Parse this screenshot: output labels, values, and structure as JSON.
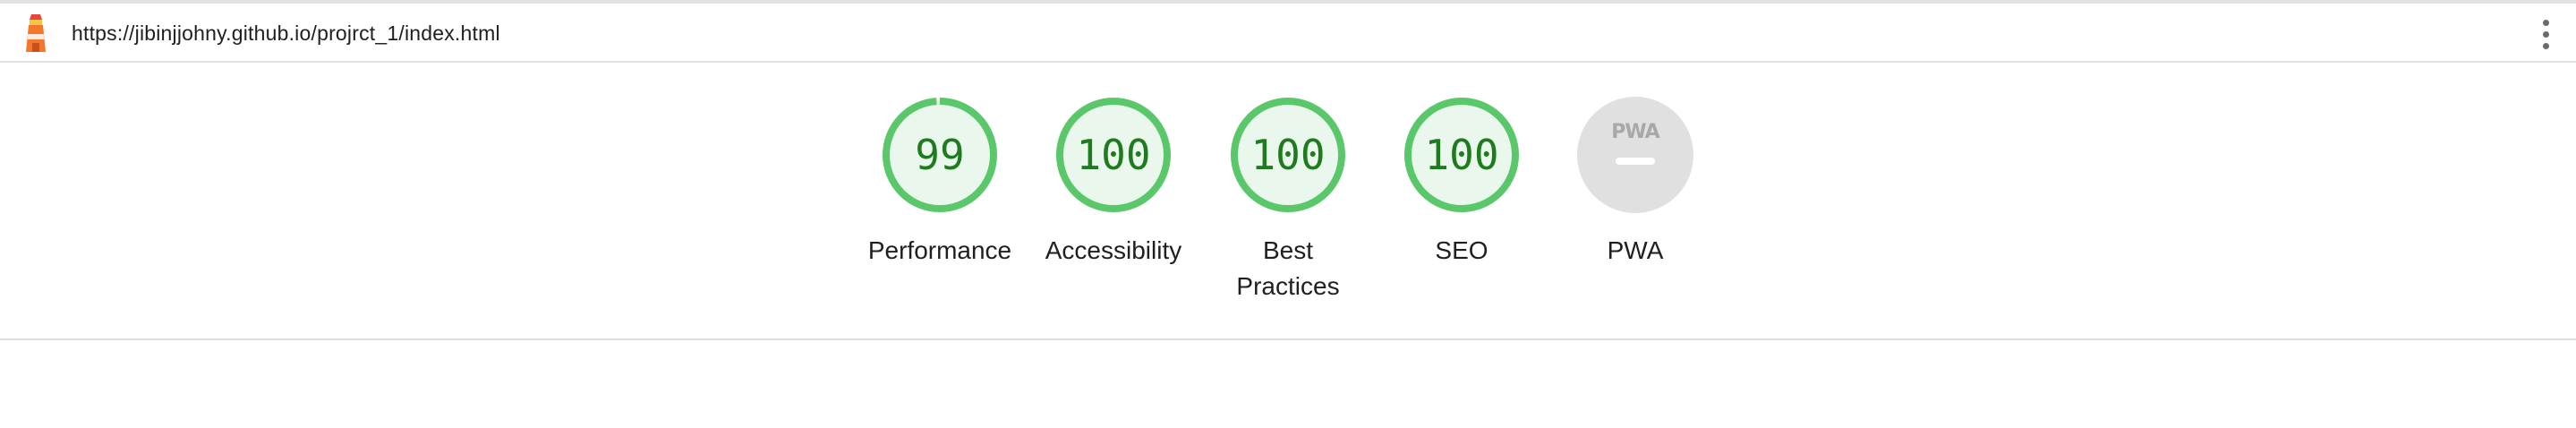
{
  "url_bar": {
    "url": "https://jibinjjohny.github.io/projrct_1/index.html",
    "logo_icon": "lighthouse-icon",
    "menu_icon": "kebab-menu-icon"
  },
  "categories": [
    {
      "id": "performance",
      "label": "Performance",
      "score": "99",
      "fill": 0.99,
      "status": "pass"
    },
    {
      "id": "accessibility",
      "label": "Accessibility",
      "score": "100",
      "fill": 1.0,
      "status": "pass"
    },
    {
      "id": "best-practices",
      "label": "Best Practices",
      "score": "100",
      "fill": 1.0,
      "status": "pass"
    },
    {
      "id": "seo",
      "label": "SEO",
      "score": "100",
      "fill": 1.0,
      "status": "pass"
    },
    {
      "id": "pwa",
      "label": "PWA",
      "badge_text": "PWA",
      "status": "not-applicable"
    }
  ],
  "colors": {
    "pass_ring": "#5ac86a",
    "pass_fill": "#eaf7ec",
    "pass_text": "#1e7b1e",
    "na_fill": "#e0e0e0",
    "na_text": "#a8a8a8",
    "logo_orange": "#f4772c",
    "logo_red": "#e8453c"
  }
}
